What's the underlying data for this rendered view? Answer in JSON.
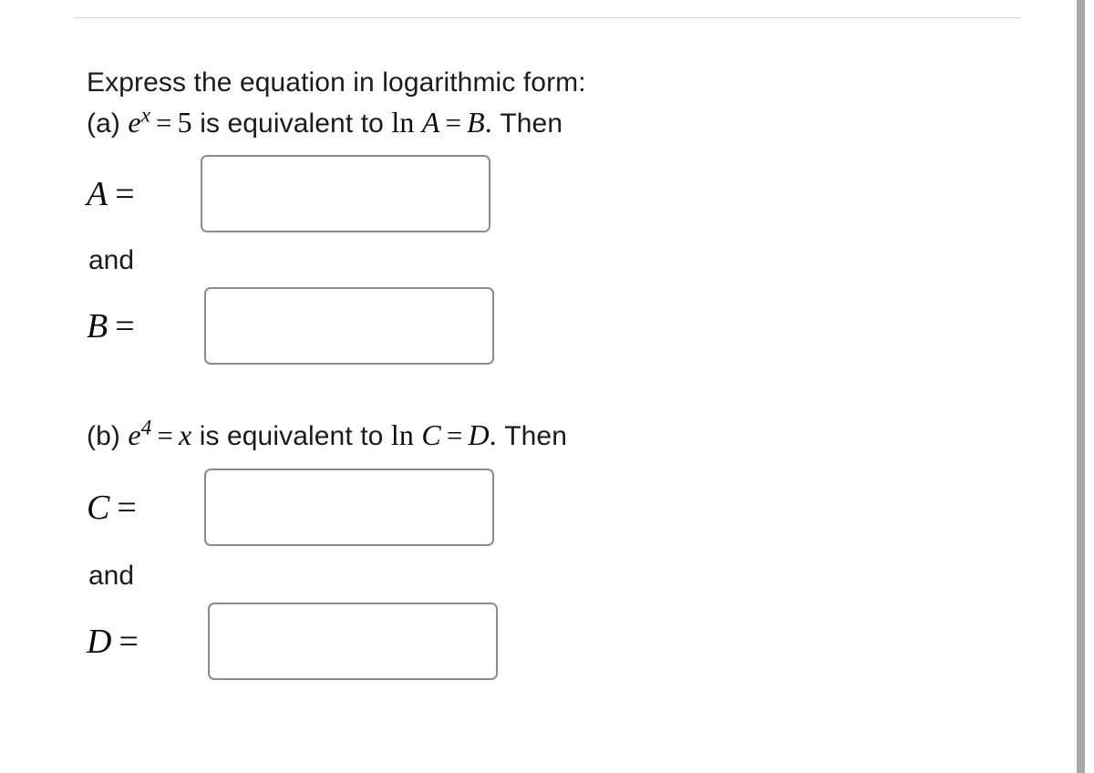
{
  "window": {
    "background_color": "#ffffff",
    "divider_color": "#d4d4d4",
    "scrollbar_color": "#a9a9a9",
    "input_border_color": "#8c8c8c",
    "text_color": "#1b1b1b",
    "clipped_fragment": "."
  },
  "question": {
    "prompt": "Express the equation in logarithmic form:",
    "parts": [
      {
        "marker": "(a)",
        "base": "e",
        "exponent": "x",
        "equals_op": "=",
        "rhs": "5",
        "connector": "is equivalent to",
        "log_fn": "ln",
        "log_arg": "A",
        "log_equals_op": "=",
        "log_rhs": "B",
        "period": ".",
        "then": "Then",
        "answers": [
          {
            "label": "A",
            "equals": "=",
            "value": "",
            "placeholder": ""
          },
          {
            "label": "B",
            "equals": "=",
            "value": "",
            "placeholder": ""
          }
        ],
        "conjunction": "and"
      },
      {
        "marker": "(b)",
        "base": "e",
        "exponent": "4",
        "equals_op": "=",
        "rhs": "x",
        "connector": "is equivalent to",
        "log_fn": "ln",
        "log_arg": "C",
        "log_equals_op": "=",
        "log_rhs": "D",
        "period": ".",
        "then": "Then",
        "answers": [
          {
            "label": "C",
            "equals": "=",
            "value": "",
            "placeholder": ""
          },
          {
            "label": "D",
            "equals": "=",
            "value": "",
            "placeholder": ""
          }
        ],
        "conjunction": "and"
      }
    ]
  }
}
